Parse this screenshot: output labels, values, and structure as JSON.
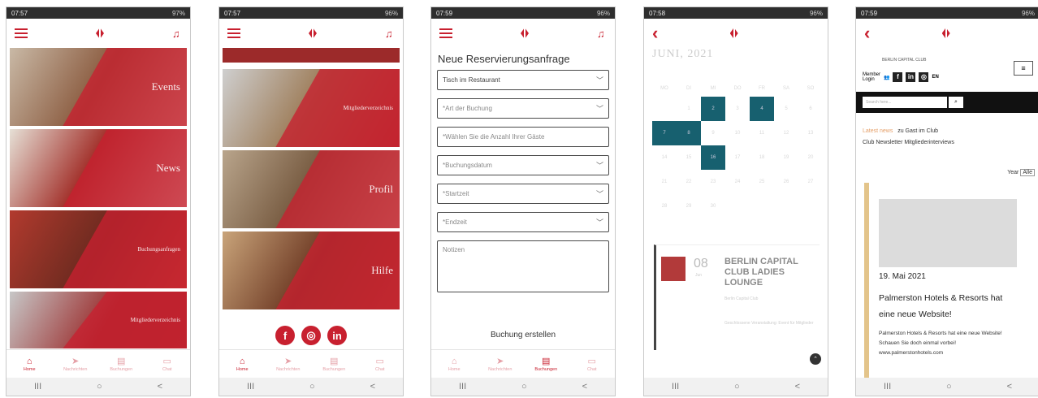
{
  "status": {
    "p1": {
      "time": "07:57",
      "right": "97%"
    },
    "p2": {
      "time": "07:57",
      "right": "96%"
    },
    "p3": {
      "time": "07:59",
      "right": "96%"
    },
    "p4": {
      "time": "07:58",
      "right": "96%"
    },
    "p5": {
      "time": "07:59",
      "right": "96%"
    }
  },
  "home": {
    "tiles": [
      "Events",
      "News",
      "Buchungsanfragen",
      "Mitgliederverzeichnis"
    ]
  },
  "more": {
    "tiles": [
      "Mitgliederverzeichnis",
      "Profil",
      "Hilfe"
    ],
    "social": [
      "f",
      "◎",
      "in"
    ]
  },
  "tabs1": [
    {
      "label": "Home",
      "icon": "⌂"
    },
    {
      "label": "Nachrichten",
      "icon": "➤"
    },
    {
      "label": "Buchungen",
      "icon": "▤"
    },
    {
      "label": "Chat",
      "icon": "▭"
    }
  ],
  "form": {
    "title": "Neue Reservierungsanfrage",
    "fields": [
      {
        "text": "Tisch im Restaurant",
        "chev": true,
        "dark": true
      },
      {
        "text": "*Art der Buchung",
        "chev": true,
        "dark": false
      },
      {
        "text": "*Wählen Sie die Anzahl Ihrer Gäste",
        "chev": false,
        "dark": false
      },
      {
        "text": "*Buchungsdatum",
        "chev": true,
        "dark": false
      },
      {
        "text": "*Startzeit",
        "chev": true,
        "dark": false
      },
      {
        "text": "*Endzeit",
        "chev": true,
        "dark": false
      }
    ],
    "notes": "Notizen",
    "submit": "Buchung erstellen"
  },
  "calendar": {
    "month": "JUNI, 2021",
    "weekdays": [
      "MO",
      "DI",
      "MI",
      "DO",
      "FR",
      "SA",
      "SO"
    ],
    "weeks": [
      [
        "",
        "1",
        "2",
        "3",
        "4",
        "5",
        "6"
      ],
      [
        "7",
        "8",
        "9",
        "10",
        "11",
        "12",
        "13"
      ],
      [
        "14",
        "15",
        "16",
        "17",
        "18",
        "19",
        "20"
      ],
      [
        "21",
        "22",
        "23",
        "24",
        "25",
        "26",
        "27"
      ],
      [
        "28",
        "29",
        "30",
        "",
        "",
        "",
        ""
      ]
    ],
    "highlighted": [
      "2",
      "4",
      "7",
      "8",
      "16"
    ],
    "event": {
      "day": "08",
      "month": "Jun",
      "title": "BERLIN CAPITAL CLUB LADIES LOUNGE",
      "location": "Berlin Capital Club",
      "desc": "Geschlossene Veranstaltung: Event für Mitglieder"
    }
  },
  "site": {
    "brand": "BERLIN CAPITAL CLUB",
    "member_login": "Member Login",
    "lang": "EN",
    "search_placeholder": "Search here...",
    "links_row1_hl": "Latest news",
    "links_row1": "zu Gast im Club",
    "links_row2": "Club Newsletter   Mitgliederinterviews",
    "year_label": "Year",
    "year_value": "Alle",
    "card_date": "19. Mai 2021",
    "card_head": "Palmerston Hotels & Resorts hat eine neue Website!",
    "card_text": "Palmerston Hotels & Resorts hat eine neue Website! Schauen Sie doch einmal vorbei! www.palmerstonhotels.com"
  },
  "colors": {
    "brand": "#c8202f",
    "teal": "#17606f"
  }
}
